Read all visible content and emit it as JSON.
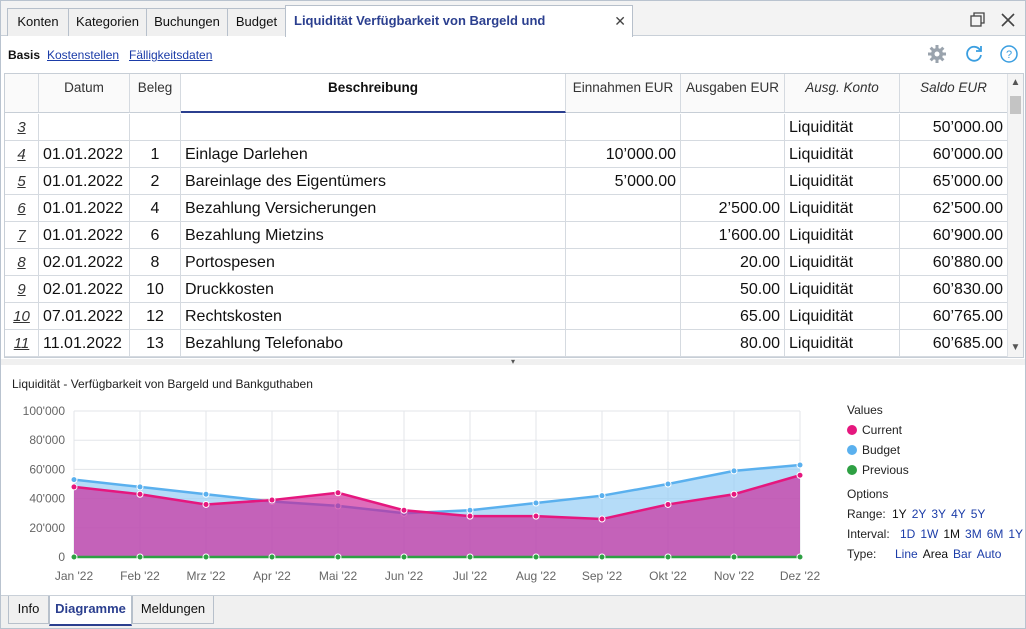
{
  "tabs": [
    {
      "label": "Konten"
    },
    {
      "label": "Kategorien"
    },
    {
      "label": "Buchungen"
    },
    {
      "label": "Budget"
    },
    {
      "label": "Liquidität Verfügbarkeit von Bargeld und Bankguthaben"
    }
  ],
  "tab_close": "✕",
  "window_controls": {
    "restore_icon": "restore-icon",
    "close_icon": "close-icon"
  },
  "views": [
    {
      "label": "Basis"
    },
    {
      "label": "Kostenstellen"
    },
    {
      "label": "Fälligkeitsdaten"
    }
  ],
  "toolbar_icons": [
    "gear-icon",
    "refresh-icon",
    "help-icon"
  ],
  "colors": {
    "accent": "#2b3f8f",
    "link": "#1b3ca8",
    "current": "#e5177e",
    "budget": "#5ab0ee",
    "previous": "#2ea043"
  },
  "table": {
    "headers": {
      "datum": "Datum",
      "beleg": "Beleg",
      "beschreibung": "Beschreibung",
      "einnahmen": "Einnahmen EUR",
      "ausgaben": "Ausgaben EUR",
      "konto": "Ausg. Konto",
      "saldo": "Saldo EUR"
    },
    "rows": [
      {
        "nr": "3",
        "datum": "",
        "beleg": "",
        "beschreibung": "",
        "einnahmen": "",
        "ausgaben": "",
        "konto": "Liquidität",
        "saldo": "50’000.00"
      },
      {
        "nr": "4",
        "datum": "01.01.2022",
        "beleg": "1",
        "beschreibung": "Einlage Darlehen",
        "einnahmen": "10’000.00",
        "ausgaben": "",
        "konto": "Liquidität",
        "saldo": "60’000.00"
      },
      {
        "nr": "5",
        "datum": "01.01.2022",
        "beleg": "2",
        "beschreibung": "Bareinlage des Eigentümers",
        "einnahmen": "5’000.00",
        "ausgaben": "",
        "konto": "Liquidität",
        "saldo": "65’000.00"
      },
      {
        "nr": "6",
        "datum": "01.01.2022",
        "beleg": "4",
        "beschreibung": "Bezahlung Versicherungen",
        "einnahmen": "",
        "ausgaben": "2’500.00",
        "konto": "Liquidität",
        "saldo": "62’500.00"
      },
      {
        "nr": "7",
        "datum": "01.01.2022",
        "beleg": "6",
        "beschreibung": "Bezahlung Mietzins",
        "einnahmen": "",
        "ausgaben": "1’600.00",
        "konto": "Liquidität",
        "saldo": "60’900.00"
      },
      {
        "nr": "8",
        "datum": "02.01.2022",
        "beleg": "8",
        "beschreibung": "Portospesen",
        "einnahmen": "",
        "ausgaben": "20.00",
        "konto": "Liquidität",
        "saldo": "60’880.00"
      },
      {
        "nr": "9",
        "datum": "02.01.2022",
        "beleg": "10",
        "beschreibung": "Druckkosten",
        "einnahmen": "",
        "ausgaben": "50.00",
        "konto": "Liquidität",
        "saldo": "60’830.00"
      },
      {
        "nr": "10",
        "datum": "07.01.2022",
        "beleg": "12",
        "beschreibung": "Rechtskosten",
        "einnahmen": "",
        "ausgaben": "65.00",
        "konto": "Liquidität",
        "saldo": "60’765.00"
      },
      {
        "nr": "11",
        "datum": "11.01.2022",
        "beleg": "13",
        "beschreibung": "Bezahlung Telefonabo",
        "einnahmen": "",
        "ausgaben": "80.00",
        "konto": "Liquidität",
        "saldo": "60’685.00"
      }
    ]
  },
  "chart": {
    "title": "Liquidität - Verfügbarkeit von Bargeld und Bankguthaben",
    "legend_title": "Values",
    "options_title": "Options",
    "options": {
      "range_label": "Range:",
      "range_values": [
        "1Y",
        "2Y",
        "3Y",
        "4Y",
        "5Y"
      ],
      "interval_label": "Interval:",
      "interval_values": [
        "1D",
        "1W",
        "1M",
        "3M",
        "6M",
        "1Y"
      ],
      "type_label": "Type:",
      "type_values": [
        "Line",
        "Area",
        "Bar",
        "Auto"
      ]
    }
  },
  "chart_data": {
    "type": "area",
    "categories": [
      "Jan '22",
      "Feb '22",
      "Mrz '22",
      "Apr '22",
      "Mai '22",
      "Jun '22",
      "Jul '22",
      "Aug '22",
      "Sep '22",
      "Okt '22",
      "Nov '22",
      "Dez '22"
    ],
    "series": [
      {
        "name": "Current",
        "values": [
          48000,
          43000,
          36000,
          39000,
          44000,
          32000,
          28000,
          28000,
          26000,
          36000,
          43000,
          56000
        ]
      },
      {
        "name": "Budget",
        "values": [
          53000,
          48000,
          43000,
          38000,
          35000,
          30000,
          32000,
          37000,
          42000,
          50000,
          59000,
          63000
        ]
      },
      {
        "name": "Previous",
        "values": [
          0,
          0,
          0,
          0,
          0,
          0,
          0,
          0,
          0,
          0,
          0,
          0
        ]
      }
    ],
    "yticks": [
      "0",
      "20'000",
      "40'000",
      "60'000",
      "80'000",
      "100'000"
    ],
    "ylim": [
      0,
      100000
    ],
    "grid": true,
    "legend": "right"
  },
  "bottom_tabs": [
    {
      "label": "Info"
    },
    {
      "label": "Diagramme"
    },
    {
      "label": "Meldungen"
    }
  ]
}
